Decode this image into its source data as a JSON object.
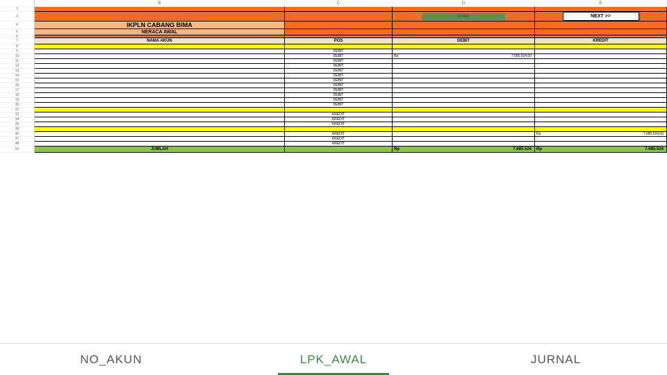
{
  "columns": {
    "B": "B",
    "C": "C",
    "D": "D",
    "E": "E"
  },
  "header": {
    "title": "IKPLN CABANG BIMA",
    "subtitle": "NERACA AWAL",
    "sama": "SAMA",
    "next": "NEXT >>"
  },
  "thead": {
    "nama": "NAMA AKUN",
    "pos": "POS",
    "debit": "DEBIT",
    "kredit": "KREDIT"
  },
  "rows": [
    {
      "n": 8,
      "hl": true
    },
    {
      "n": 9,
      "pos": "DEBIT"
    },
    {
      "n": 10,
      "pos": "DEBIT",
      "d_rp": "Rp",
      "d_val": "7.685.524,00"
    },
    {
      "n": 11,
      "pos": "DEBIT"
    },
    {
      "n": 12,
      "pos": "DEBIT"
    },
    {
      "n": 13,
      "pos": "DEBIT"
    },
    {
      "n": 14,
      "pos": "DEBIT"
    },
    {
      "n": 15,
      "pos": "DEBIT"
    },
    {
      "n": 16,
      "pos": "DEBIT"
    },
    {
      "n": 17,
      "pos": "DEBIT"
    },
    {
      "n": 18,
      "pos": "DEBIT"
    },
    {
      "n": 19,
      "pos": "DEBIT"
    },
    {
      "n": 30,
      "pos": "DEBIT"
    },
    {
      "n": 31,
      "hl": true
    },
    {
      "n": 33,
      "pos": "KREDIT"
    },
    {
      "n": 34,
      "pos": "KREDIT"
    },
    {
      "n": 35,
      "pos": "KREDIT"
    },
    {
      "n": 36,
      "hl": true
    },
    {
      "n": 46,
      "pos": "KREDIT",
      "k_rp": "Rp",
      "k_val": "7.685.524,00"
    },
    {
      "n": 47,
      "pos": "KREDIT"
    },
    {
      "n": 48,
      "pos": "KREDIT"
    }
  ],
  "total": {
    "label": "JUMLAH",
    "d_rp": "Rp",
    "d_val": "7.685.524",
    "k_rp": "Rp",
    "k_val": "7.685.524",
    "n": 50
  },
  "tabs": {
    "a": "NO_AKUN",
    "b": "LPK_AWAL",
    "c": "JURNAL"
  }
}
